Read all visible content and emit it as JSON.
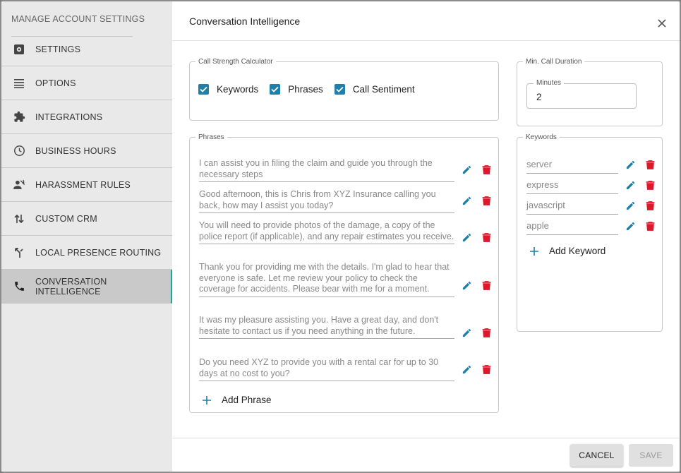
{
  "sidebar": {
    "header": "MANAGE ACCOUNT SETTINGS",
    "items": [
      {
        "label": "SETTINGS",
        "icon": "gear-icon"
      },
      {
        "label": "OPTIONS",
        "icon": "list-icon"
      },
      {
        "label": "INTEGRATIONS",
        "icon": "puzzle-icon"
      },
      {
        "label": "BUSINESS HOURS",
        "icon": "clock-icon"
      },
      {
        "label": "HARASSMENT RULES",
        "icon": "voice-off-icon"
      },
      {
        "label": "CUSTOM CRM",
        "icon": "swap-vertical-icon"
      },
      {
        "label": "LOCAL PRESENCE ROUTING",
        "icon": "routing-icon"
      },
      {
        "label": "CONVERSATION INTELLIGENCE",
        "icon": "phone-icon",
        "active": true
      }
    ]
  },
  "dialog": {
    "title": "Conversation Intelligence"
  },
  "call_strength": {
    "legend": "Call Strength Calculator",
    "options": [
      {
        "label": "Keywords",
        "checked": true
      },
      {
        "label": "Phrases",
        "checked": true
      },
      {
        "label": "Call Sentiment",
        "checked": true
      }
    ]
  },
  "min_duration": {
    "legend": "Min. Call Duration",
    "field_label": "Minutes",
    "value": "2"
  },
  "phrases": {
    "legend": "Phrases",
    "items": [
      "I can assist you in filing the claim and guide you through the necessary steps",
      "Good afternoon, this is Chris from XYZ Insurance calling you back, how may I assist you today?",
      "You will need to provide photos of the damage, a copy of the police report (if applicable), and any repair estimates you receive.",
      "Thank you for providing me with the details. I'm glad to hear that everyone is safe. Let me review your policy to check the coverage for accidents. Please bear with me for a moment.",
      "It was my pleasure assisting you. Have a great day, and don't hesitate to contact us if you need anything in the future.",
      "Do you need XYZ to provide you with a rental car for up to 30 days at no cost to you?"
    ],
    "add_label": "Add Phrase"
  },
  "keywords": {
    "legend": "Keywords",
    "items": [
      "server",
      "express",
      "javascript",
      "apple"
    ],
    "add_label": "Add Keyword"
  },
  "footer": {
    "cancel_label": "CANCEL",
    "save_label": "SAVE"
  },
  "colors": {
    "accent": "#1f7fa8",
    "delete": "#e0162b",
    "active_border": "#1aa88e"
  }
}
